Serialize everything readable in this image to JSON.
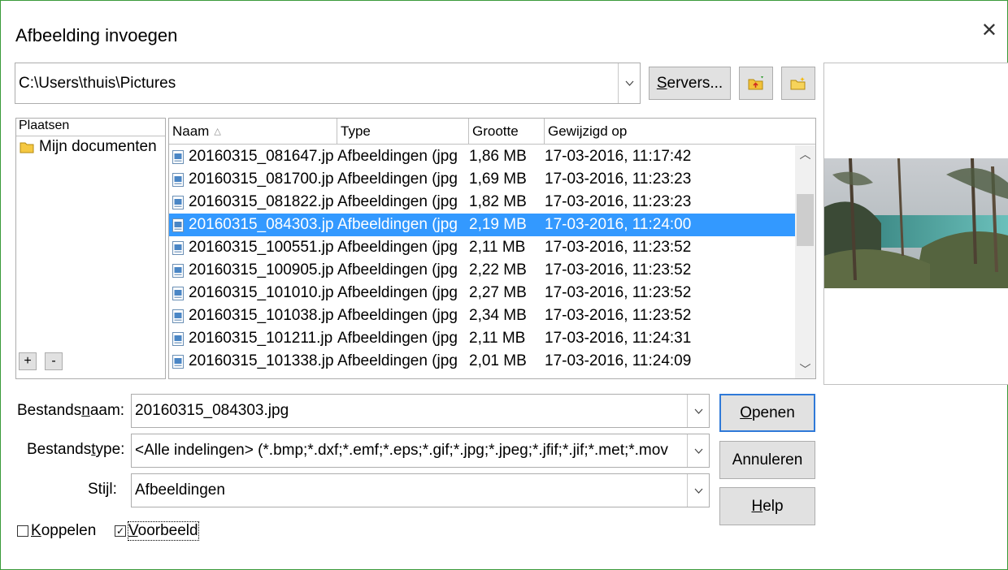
{
  "window": {
    "title": "Afbeelding invoegen"
  },
  "path": {
    "value": "C:\\Users\\thuis\\Pictures"
  },
  "toolbar": {
    "servers_label": "Servers...",
    "servers_underline": "S",
    "servers_rest": "ervers..."
  },
  "places": {
    "header": "Plaatsen",
    "items": [
      {
        "label": "Mijn documenten"
      }
    ],
    "add_label": "+",
    "remove_label": "-"
  },
  "filelist": {
    "columns": {
      "name": "Naam",
      "sort_glyph": "△",
      "type": "Type",
      "size": "Grootte",
      "modified": "Gewijzigd op"
    },
    "rows": [
      {
        "name": "20160315_081647.jp",
        "type": "Afbeeldingen (jpg",
        "size": "1,86 MB",
        "modified": "17-03-2016, 11:17:42"
      },
      {
        "name": "20160315_081700.jp",
        "type": "Afbeeldingen (jpg",
        "size": "1,69 MB",
        "modified": "17-03-2016, 11:23:23"
      },
      {
        "name": "20160315_081822.jp",
        "type": "Afbeeldingen (jpg",
        "size": "1,82 MB",
        "modified": "17-03-2016, 11:23:23"
      },
      {
        "name": "20160315_084303.jp",
        "type": "Afbeeldingen (jpg",
        "size": "2,19 MB",
        "modified": "17-03-2016, 11:24:00"
      },
      {
        "name": "20160315_100551.jp",
        "type": "Afbeeldingen (jpg",
        "size": "2,11 MB",
        "modified": "17-03-2016, 11:23:52"
      },
      {
        "name": "20160315_100905.jp",
        "type": "Afbeeldingen (jpg",
        "size": "2,22 MB",
        "modified": "17-03-2016, 11:23:52"
      },
      {
        "name": "20160315_101010.jp",
        "type": "Afbeeldingen (jpg",
        "size": "2,27 MB",
        "modified": "17-03-2016, 11:23:52"
      },
      {
        "name": "20160315_101038.jp",
        "type": "Afbeeldingen (jpg",
        "size": "2,34 MB",
        "modified": "17-03-2016, 11:23:52"
      },
      {
        "name": "20160315_101211.jp",
        "type": "Afbeeldingen (jpg",
        "size": "2,11 MB",
        "modified": "17-03-2016, 11:24:31"
      },
      {
        "name": "20160315_101338.jp",
        "type": "Afbeeldingen (jpg",
        "size": "2,01 MB",
        "modified": "17-03-2016, 11:24:09"
      }
    ],
    "selected_index": 3
  },
  "form": {
    "filename_label_pre": "Bestands",
    "filename_label_u": "n",
    "filename_label_post": "aam:",
    "filename_value": "20160315_084303.jpg",
    "filetype_label_pre": "Bestands",
    "filetype_label_u": "t",
    "filetype_label_post": "ype:",
    "filetype_value": "<Alle indelingen> (*.bmp;*.dxf;*.emf;*.eps;*.gif;*.jpg;*.jpeg;*.jfif;*.jif;*.met;*.mov",
    "style_label": "Stijl:",
    "style_value": "Afbeeldingen"
  },
  "buttons": {
    "open_u": "O",
    "open_rest": "penen",
    "cancel": "Annuleren",
    "help_u": "H",
    "help_rest": "elp"
  },
  "options": {
    "link_u": "K",
    "link_rest": "oppelen",
    "link_checked": false,
    "preview_u": "V",
    "preview_rest": "oorbeeld",
    "preview_checked": true
  },
  "colors": {
    "selection": "#3399ff",
    "default_button_border": "#2f79d8",
    "folder": "#f5c842"
  }
}
